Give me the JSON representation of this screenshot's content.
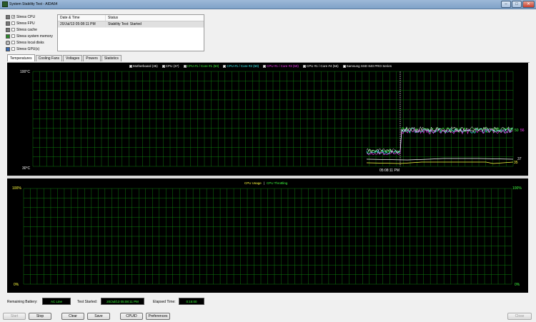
{
  "window": {
    "title": "System Stability Test - AIDA64"
  },
  "stress": [
    {
      "label": "Stress CPU",
      "checked": true
    },
    {
      "label": "Stress FPU",
      "checked": false
    },
    {
      "label": "Stress cache",
      "checked": false
    },
    {
      "label": "Stress system memory",
      "checked": false
    },
    {
      "label": "Stress local disks",
      "checked": false
    },
    {
      "label": "Stress GPU(s)",
      "checked": false
    }
  ],
  "status_table": {
    "headers": [
      "Date & Time",
      "Status"
    ],
    "rows": [
      {
        "datetime": "20/Jul/13 05:08:11 PM",
        "status": "Stability Test: Started"
      }
    ]
  },
  "tabs": [
    "Temperatures",
    "Cooling Fans",
    "Voltages",
    "Powers",
    "Statistics"
  ],
  "temp_chart": {
    "legend": [
      {
        "label": "Motherboard (35)",
        "color": "#ffffff"
      },
      {
        "label": "CPU (37)",
        "color": "#ffffff"
      },
      {
        "label": "CPU #1 / Core #1 (50)",
        "color": "#40ff40"
      },
      {
        "label": "CPU #1 / Core #2 (50)",
        "color": "#40ffff"
      },
      {
        "label": "CPU #1 / Core #3 (50)",
        "color": "#ff40ff"
      },
      {
        "label": "CPU #1 / Core #4 (56)",
        "color": "#ffffff"
      },
      {
        "label": "Samsung SSD 840 PRO Series",
        "color": "#ffffff"
      }
    ],
    "ymax_label": "100°C",
    "ymin_label": "30°C",
    "time_label": "05:08:11 PM",
    "end_labels": [
      "50",
      "56",
      "37",
      "35"
    ],
    "unit": "°C",
    "ylim": [
      30,
      100
    ]
  },
  "usage_chart": {
    "legend_a": "CPU Usage",
    "legend_sep": "|",
    "legend_b": "CPU Throttling",
    "left_top": "100%",
    "left_bottom": "0%",
    "right_top": "100%",
    "right_bottom": "0%"
  },
  "info": {
    "battery_label": "Remaining Battery:",
    "battery_value": "AC Line",
    "started_label": "Test Started:",
    "started_value": "20/Jul/13 05:08:11 PM",
    "elapsed_label": "Elapsed Time:",
    "elapsed_value": "0:15:00"
  },
  "buttons": {
    "start": "Start",
    "stop": "Stop",
    "clear": "Clear",
    "save": "Save",
    "cpuid": "CPUID",
    "preferences": "Preferences",
    "close": "Close"
  }
}
